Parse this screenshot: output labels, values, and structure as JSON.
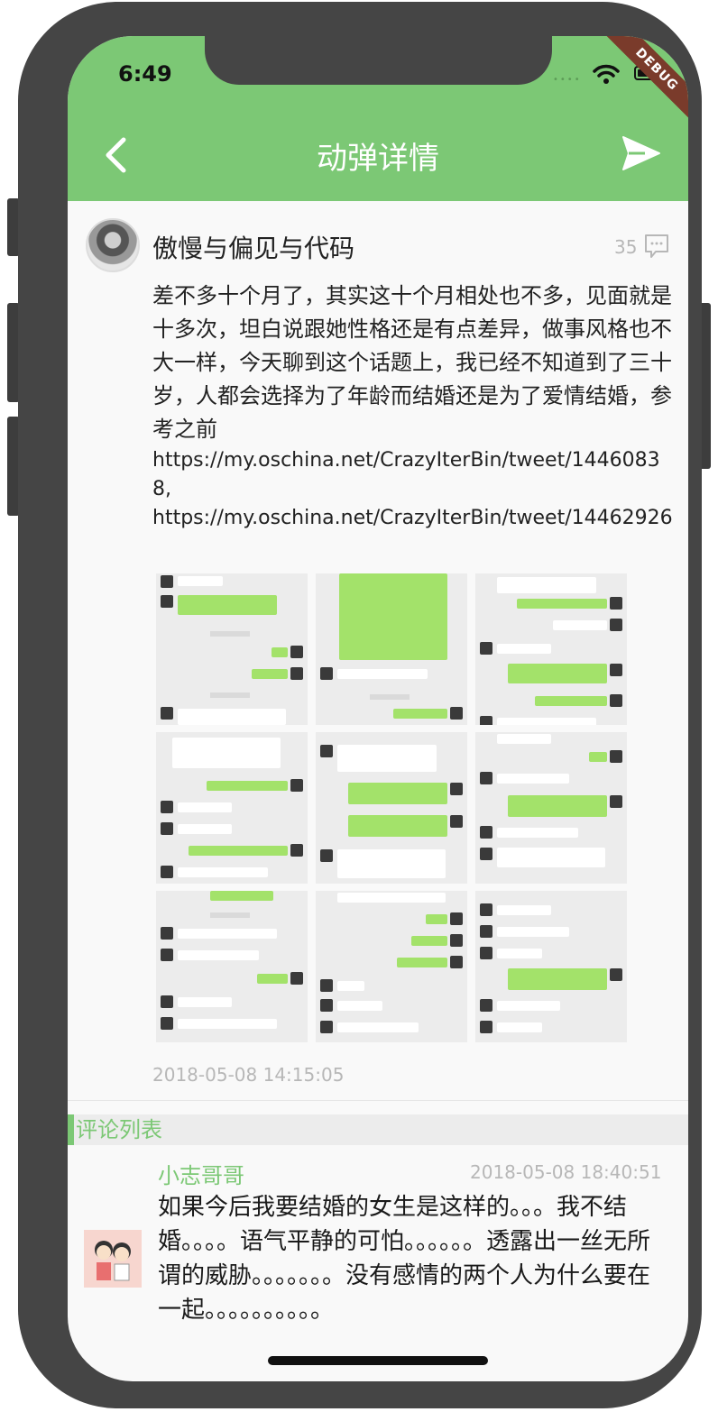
{
  "status_bar": {
    "time": "6:49",
    "debug_label": "DEBUG"
  },
  "app_bar": {
    "title": "动弹详情",
    "back_icon": "chevron-left-icon",
    "send_icon": "send-icon"
  },
  "post": {
    "author": "傲慢与偏见与代码",
    "comment_count": "35",
    "text": "差不多十个月了，其实这十个月相处也不多，见面就是十多次，坦白说跟她性格还是有点差异，做事风格也不大一样，今天聊到这个话题上，我已经不知道到了三十岁，人都会选择为了年龄而结婚还是为了爱情结婚，参考之前",
    "links": [
      "https://my.oschina.net/CrazyIterBin/tweet/14460838,",
      "https://my.oschina.net/CrazyIterBin/tweet/14462926"
    ],
    "image_count": 9,
    "time": "2018-05-08 14:15:05"
  },
  "comments_section": {
    "title": "评论列表"
  },
  "comments": [
    {
      "name": "小志哥哥",
      "time": "2018-05-08 18:40:51",
      "text": "如果今后我要结婚的女生是这样的。。。我不结婚。。。。语气平静的可怕。。。。。。透露出一丝无所谓的威胁。。。。。。。没有感情的两个人为什么要在一起。。。。。。。。。。"
    }
  ],
  "colors": {
    "accent": "#7cc875",
    "muted": "#b7b7b7",
    "text": "#222222"
  }
}
